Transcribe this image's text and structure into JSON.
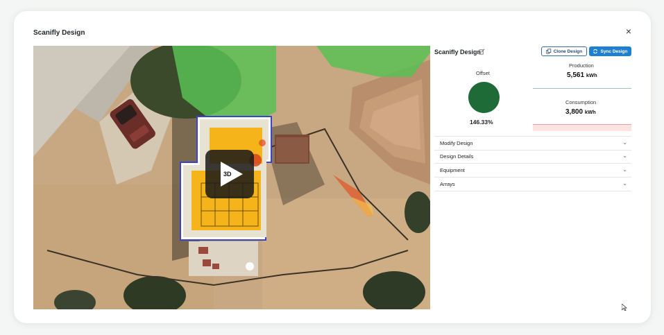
{
  "modal": {
    "title": "Scanifly Design",
    "close_glyph": "×"
  },
  "viewer": {
    "play_label": "3D",
    "play_icon": "play-icon"
  },
  "panel": {
    "title": "Scanifly Design",
    "clone_label": "Clone Design",
    "sync_label": "Sync Design",
    "offset": {
      "label": "Offset",
      "value": "146.33%",
      "color": "#1e6b37"
    },
    "production": {
      "label": "Production",
      "value": "5,561",
      "unit": "kWh"
    },
    "consumption": {
      "label": "Consumption",
      "value": "3,800",
      "unit": "kWh"
    },
    "sections": [
      {
        "label": "Modify Design"
      },
      {
        "label": "Design Details"
      },
      {
        "label": "Equipment"
      },
      {
        "label": "Arrays"
      }
    ],
    "chevron": "⌄"
  },
  "colors": {
    "accent": "#1f7fd0",
    "offset_green": "#1e6b37",
    "panel_yellow": "#f5b51a"
  }
}
